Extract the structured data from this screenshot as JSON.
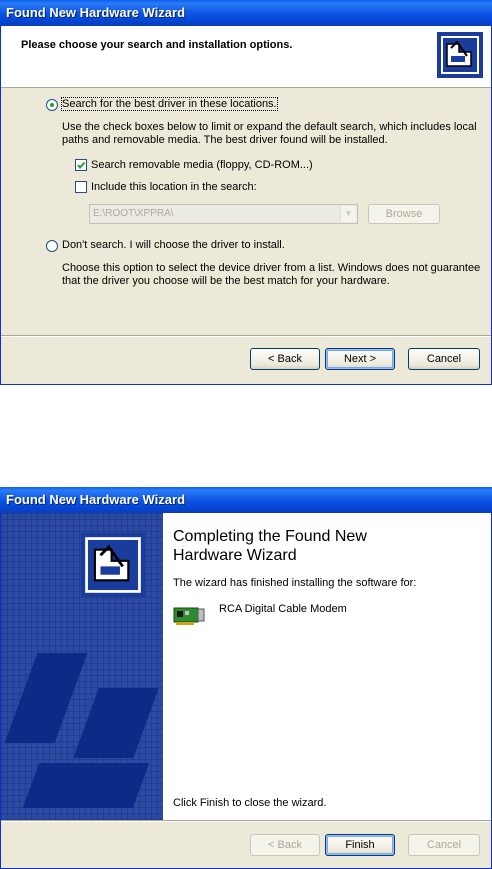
{
  "window1": {
    "title": "Found New Hardware Wizard",
    "header": "Please choose your search and installation options.",
    "option_search": "Search for the best driver in these locations.",
    "option_search_desc": "Use the check boxes below to limit or expand the default search, which includes local paths and removable media. The best driver found will be installed.",
    "check_removable": "Search removable media (floppy, CD-ROM...)",
    "check_location": "Include this location in the search:",
    "location_value": "E:\\ROOT\\XPPRA\\",
    "browse": "Browse",
    "option_dont": "Don't search. I will choose the driver to install.",
    "option_dont_desc": "Choose this option to select the device driver from a list. Windows does not guarantee that the driver you choose will be the best match for your hardware.",
    "back": "< Back",
    "next": "Next >",
    "cancel": "Cancel"
  },
  "window2": {
    "title": "Found New Hardware Wizard",
    "completion_title_line1": "Completing the Found New",
    "completion_title_line2": "Hardware Wizard",
    "finished_text": "The wizard has finished installing the software for:",
    "device_name": "RCA Digital Cable Modem",
    "close_text": "Click Finish to close the wizard.",
    "back": "< Back",
    "finish": "Finish",
    "cancel": "Cancel"
  },
  "colors": {
    "title_blue": "#0a52e3",
    "dialog_bg": "#ece9d8",
    "side_panel": "#2a4aa6"
  },
  "icons": {
    "header": "hardware-wizard-icon",
    "device": "network-card-icon"
  }
}
